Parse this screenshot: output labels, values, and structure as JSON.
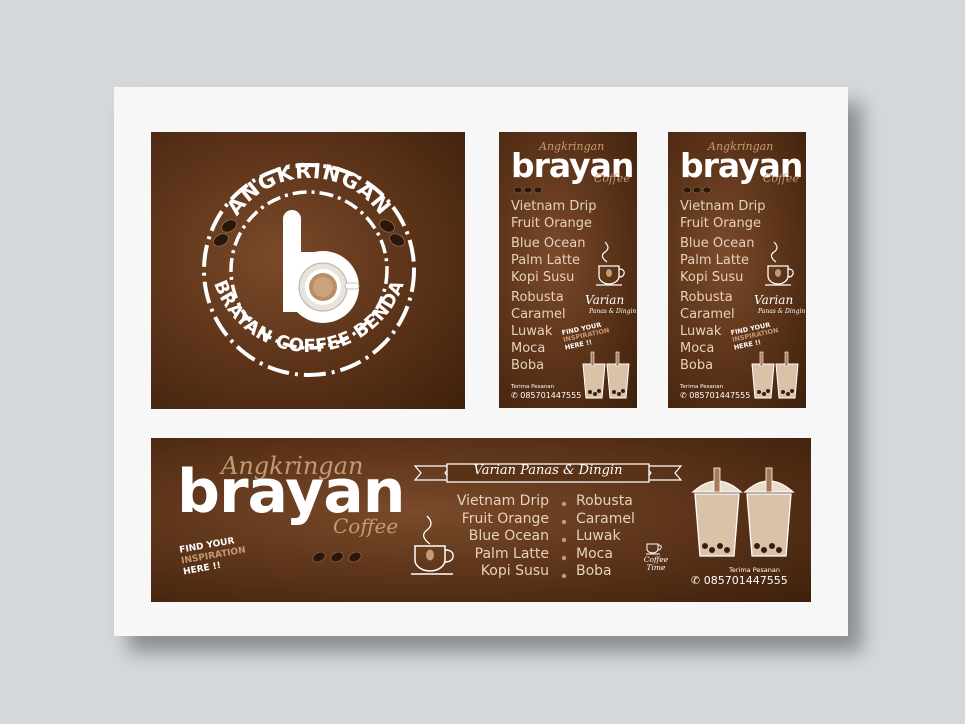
{
  "logo": {
    "arc_top": "ANGKRINGAN",
    "arc_bottom": "BRAYAN COFFEE BENDA",
    "letter": "b"
  },
  "vertical_banner": {
    "script_top": "Angkringan",
    "brand": "brayan",
    "script_bottom": "Coffee",
    "menu_group_1": [
      "Vietnam Drip",
      "Fruit Orange",
      "Blue Ocean",
      "Palm Latte",
      "Kopi Susu"
    ],
    "menu_group_2": [
      "Robusta",
      "Caramel",
      "Luwak",
      "Moca",
      "Boba"
    ],
    "varian": "Varian",
    "varian_sub": "Panas & Dingin",
    "find_line1": "FIND YOUR",
    "find_line2": "INSPIRATION",
    "find_line3": "HERE !!",
    "order_label": "Terima Pesanan",
    "phone": "085701447555"
  },
  "horizontal_banner": {
    "script_top": "Angkringan",
    "brand": "brayan",
    "script_bottom": "Coffee",
    "ribbon": "Varian Panas & Dingin",
    "menu_left": [
      "Vietnam Drip",
      "Fruit Orange",
      "Blue Ocean",
      "Palm Latte",
      "Kopi Susu"
    ],
    "menu_right": [
      "Robusta",
      "Caramel",
      "Luwak",
      "Moca",
      "Boba"
    ],
    "find_line1": "FIND YOUR",
    "find_line2": "INSPIRATION",
    "find_line3": "HERE !!",
    "coffee_time": "Coffee Time",
    "order_label": "Terima Pesanan",
    "phone": "085701447555"
  },
  "colors": {
    "brown_dark": "#3d200c",
    "brown_mid": "#5a3218",
    "accent_tan": "#c49a74",
    "cream_text": "#e7d2bd"
  }
}
